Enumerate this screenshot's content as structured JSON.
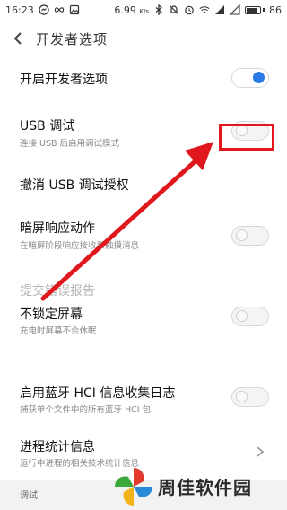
{
  "status_bar": {
    "time": "16:23",
    "speed": "6.99",
    "speed_unit": "K/s",
    "battery": "86",
    "battery_level": 0.86
  },
  "header": {
    "title": "开发者选项"
  },
  "rows": [
    {
      "title": "开启开发者选项",
      "toggle": true
    },
    {
      "title": "USB 调试",
      "subtitle": "连接 USB 后启用调试模式",
      "toggle": false
    },
    {
      "title": "撤消 USB 调试授权"
    },
    {
      "title": "暗屏响应动作",
      "subtitle": "在暗屏阶段响应接收和触摸消息",
      "toggle": false
    },
    {
      "title": "提交错误报告"
    },
    {
      "title": "不锁定屏幕",
      "subtitle": "充电时屏幕不会休眠",
      "toggle": false
    },
    {
      "title": "启用蓝牙 HCI 信息收集日志",
      "subtitle": "捕获单个文件中的所有蓝牙 HCI 包",
      "toggle": false
    },
    {
      "title": "进程统计信息",
      "subtitle": "运行中进程的相关技术统计信息"
    }
  ],
  "footer_section": "调试",
  "watermark": {
    "text": "周佳软件园"
  },
  "colors": {
    "accent": "#2b7ae8",
    "highlight": "#e0181d"
  }
}
